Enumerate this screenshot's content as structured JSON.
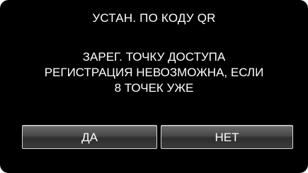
{
  "dialog": {
    "title": "УСТАН. ПО КОДУ QR",
    "message_lines": [
      "ЗАРЕГ. ТОЧКУ ДОСТУПА",
      "РЕГИСТРАЦИЯ НЕВОЗМОЖНА, ЕСЛИ",
      "8 ТОЧЕК УЖЕ"
    ],
    "yes_label": "ДА",
    "no_label": "НЕТ"
  },
  "colors": {
    "background": "#000000",
    "text": "#ffffff",
    "button_border": "#d8d8d8"
  }
}
